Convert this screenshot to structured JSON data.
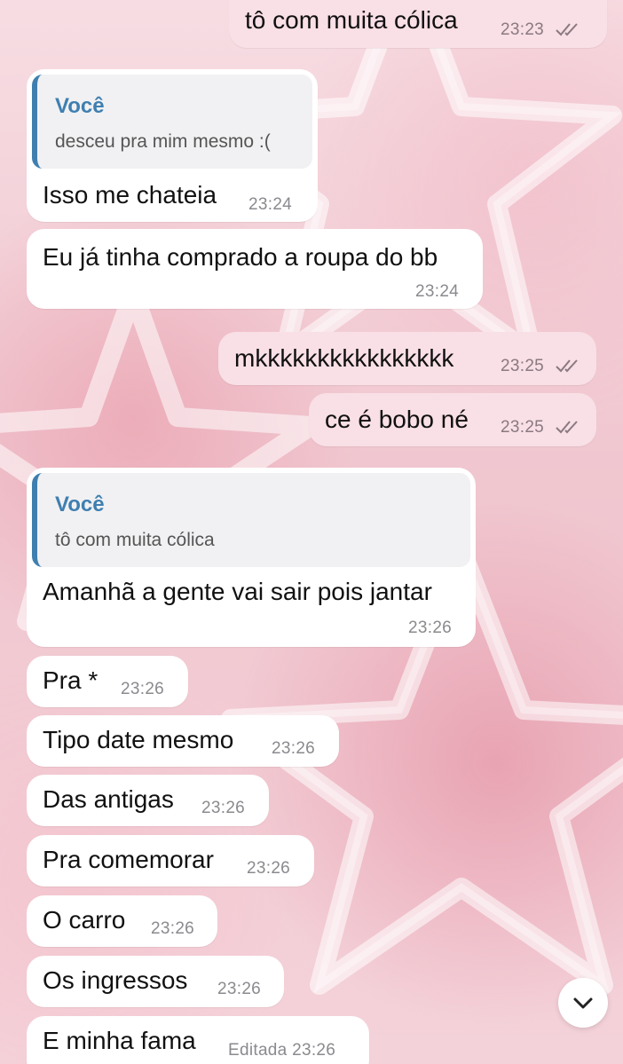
{
  "messages": [
    {
      "direction": "out",
      "text": "tô com muita cólica",
      "time": "23:23",
      "status": "read"
    },
    {
      "direction": "in",
      "reply_to": {
        "author": "Você",
        "text": "desceu pra mim mesmo :("
      },
      "text": "Isso me chateia",
      "time": "23:24"
    },
    {
      "direction": "in",
      "text": "Eu já tinha comprado a roupa do bb",
      "time": "23:24"
    },
    {
      "direction": "out",
      "text": "mkkkkkkkkkkkkkkkk",
      "time": "23:25",
      "status": "read"
    },
    {
      "direction": "out",
      "text": "ce é bobo né",
      "time": "23:25",
      "status": "read"
    },
    {
      "direction": "in",
      "reply_to": {
        "author": "Você",
        "text": "tô com muita cólica"
      },
      "text": "Amanhã a gente vai sair pois jantar",
      "time": "23:26"
    },
    {
      "direction": "in",
      "text": "Pra *",
      "time": "23:26"
    },
    {
      "direction": "in",
      "text": "Tipo date mesmo",
      "time": "23:26"
    },
    {
      "direction": "in",
      "text": "Das antigas",
      "time": "23:26"
    },
    {
      "direction": "in",
      "text": "Pra comemorar",
      "time": "23:26"
    },
    {
      "direction": "in",
      "text": "O carro",
      "time": "23:26"
    },
    {
      "direction": "in",
      "text": "Os ingressos",
      "time": "23:26"
    },
    {
      "direction": "in",
      "text": "E minha fama",
      "time": "Editada 23:26"
    }
  ],
  "icons": {
    "read_ticks": "double-check-icon",
    "scroll_button": "chevron-down-icon"
  },
  "colors": {
    "incoming_bubble": "#ffffff",
    "outgoing_bubble": "#f9dfe6",
    "reply_accent": "#3f7fb0",
    "background": "#f0c6cf"
  }
}
